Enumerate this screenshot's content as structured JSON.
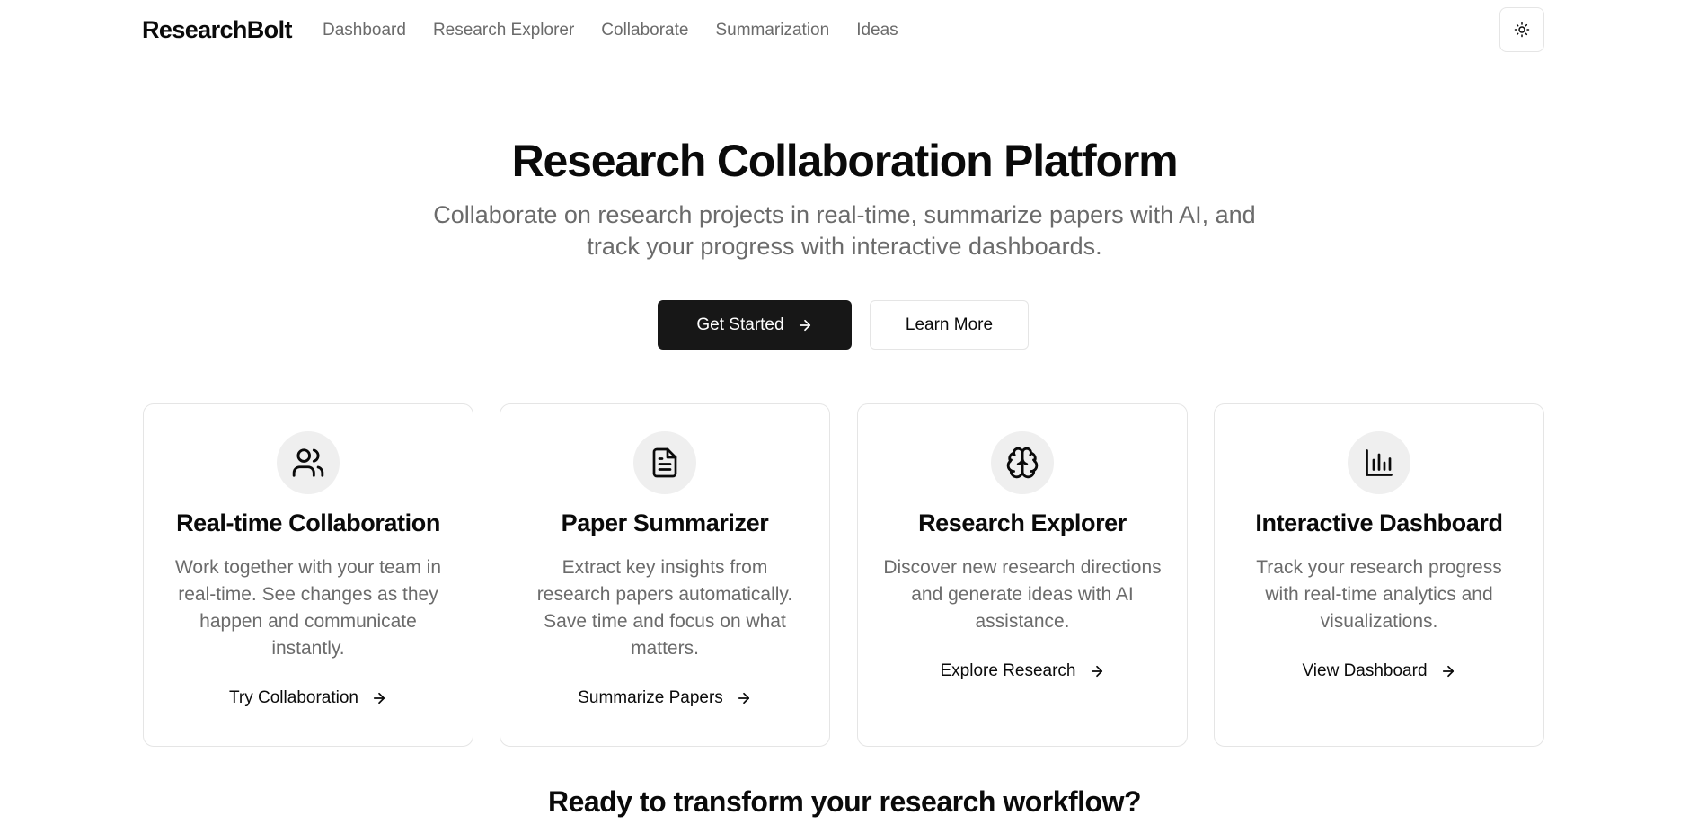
{
  "header": {
    "brand": "ResearchBolt",
    "nav": [
      "Dashboard",
      "Research Explorer",
      "Collaborate",
      "Summarization",
      "Ideas"
    ],
    "theme_icon": "sun-icon"
  },
  "hero": {
    "title": "Research Collaboration Platform",
    "subtitle": "Collaborate on research projects in real-time, summarize papers with AI, and track your progress with interactive dashboards.",
    "primary_button": "Get Started",
    "secondary_button": "Learn More"
  },
  "features": [
    {
      "icon": "users-icon",
      "title": "Real-time Collaboration",
      "description": "Work together with your team in real-time. See changes as they happen and communicate instantly.",
      "link": "Try Collaboration"
    },
    {
      "icon": "document-icon",
      "title": "Paper Summarizer",
      "description": "Extract key insights from research papers automatically. Save time and focus on what matters.",
      "link": "Summarize Papers"
    },
    {
      "icon": "brain-icon",
      "title": "Research Explorer",
      "description": "Discover new research directions and generate ideas with AI assistance.",
      "link": "Explore Research"
    },
    {
      "icon": "bar-chart-icon",
      "title": "Interactive Dashboard",
      "description": "Track your research progress with real-time analytics and visualizations.",
      "link": "View Dashboard"
    }
  ],
  "cta": {
    "title": "Ready to transform your research workflow?"
  },
  "colors": {
    "primary": "#171717",
    "muted_text": "#6b6b6b",
    "border": "#e5e5e5",
    "icon_bg": "#efefef"
  }
}
